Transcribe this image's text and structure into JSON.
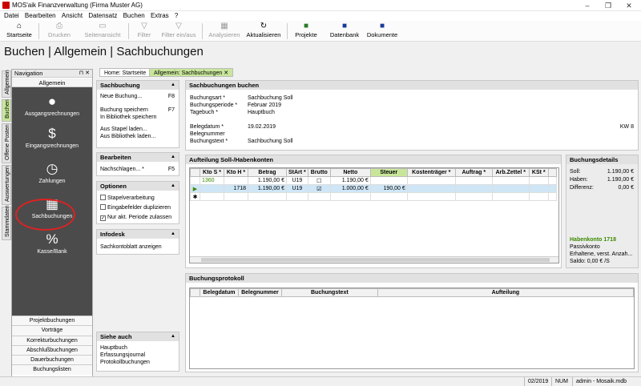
{
  "window": {
    "title": "MOS'aik Finanzverwaltung (Firma Muster AG)",
    "minimize": "–",
    "maximize": "❐",
    "close": "✕"
  },
  "menu": [
    "Datei",
    "Bearbeiten",
    "Ansicht",
    "Datensatz",
    "Buchen",
    "Extras",
    "?"
  ],
  "toolbar": {
    "startseite": "Startseite",
    "drucken": "Drucken",
    "seitenansicht": "Seitenansicht",
    "filter": "Filter",
    "filter_einaus": "Filter ein/aus",
    "analysieren": "Analysieren",
    "aktualisieren": "Aktualisieren",
    "projekte": "Projekte",
    "datenbank": "Datenbank",
    "dokumente": "Dokumente"
  },
  "page_title": "Buchen | Allgemein | Sachbuchungen",
  "navigation": {
    "header": "Navigation",
    "pin": "⊓ ✕",
    "section": "Allgemein",
    "items": [
      "Ausgangsrechnungen",
      "Eingangsrechnungen",
      "Zahlungen",
      "Sachbuchungen",
      "Kasse/Bank"
    ],
    "list": [
      "Projektbuchungen",
      "Vorträge",
      "Korrekturbuchungen",
      "Abschlußbuchungen",
      "Dauerbuchungen",
      "Buchungslisten"
    ]
  },
  "vertical_tabs": [
    "Allgemein",
    "Buchen",
    "Offene Posten",
    "Auswertungen",
    "Stammdaten"
  ],
  "tabs": {
    "home": "Home: Startseite",
    "active": "Allgemein: Sachbuchungen",
    "close": "✕"
  },
  "actions": {
    "sachbuchung": {
      "title": "Sachbuchung",
      "neue": "Neue Buchung...",
      "neue_key": "F8",
      "speichern": "Buchung speichern",
      "speichern_key": "F7",
      "bibliothek_speichern": "In Bibliothek speichern",
      "stapel_laden": "Aus Stapel laden...",
      "bibliothek_laden": "Aus Bibliothek laden..."
    },
    "bearbeiten": {
      "title": "Bearbeiten",
      "nachschlagen": "Nachschlagen...",
      "nachschlagen_star": "*",
      "nachschlagen_key": "F5"
    },
    "optionen": {
      "title": "Optionen",
      "stapel": "Stapelverarbeitung",
      "duplizieren": "Eingabefelder duplizieren",
      "periode": "Nur akt. Periode zulassen",
      "check": "✓"
    },
    "infodesk": {
      "title": "Infodesk",
      "konto": "Sachkontoblatt anzeigen"
    },
    "siehe_auch": {
      "title": "Siehe auch",
      "items": [
        "Hauptbuch",
        "Erfassungsjournal",
        "Protokollbuchungen"
      ]
    }
  },
  "form": {
    "title": "Sachbuchungen buchen",
    "buchungsart_lbl": "Buchungsart *",
    "buchungsart": "Sachbuchung Soll",
    "buchungsperiode_lbl": "Buchungsperiode *",
    "buchungsperiode": "Februar 2019",
    "tagebuch_lbl": "Tagebuch *",
    "tagebuch": "Hauptbuch",
    "belegdatum_lbl": "Belegdatum *",
    "belegdatum": "19.02.2019",
    "kw": "KW 8",
    "belegnummer_lbl": "Belegnummer",
    "buchungstext_lbl": "Buchungstext *",
    "buchungstext": "Sachbuchung Soll"
  },
  "aufteilung": {
    "title": "Aufteilung Soll-/Habenkonten",
    "columns": [
      "Kto S *",
      "Kto H *",
      "Betrag",
      "StArt *",
      "Brutto",
      "Netto",
      "Steuer",
      "Kostenträger *",
      "Auftrag *",
      "Arb.Zettel *",
      "KSt *"
    ],
    "rows": [
      {
        "marker": "",
        "kto_s": "1360",
        "kto_h": "",
        "betrag": "1.190,00 €",
        "start": "U19",
        "brutto": "☐",
        "netto": "1.190,00 €",
        "steuer": ""
      },
      {
        "marker": "▶",
        "kto_s": "",
        "kto_h": "1718",
        "betrag": "1.190,00 €",
        "start": "U19",
        "brutto": "☑",
        "netto": "1.000,00 €",
        "steuer": "190,00 €"
      },
      {
        "marker": "✱",
        "kto_s": "",
        "kto_h": "",
        "betrag": "",
        "start": "",
        "brutto": "",
        "netto": "",
        "steuer": ""
      }
    ]
  },
  "details": {
    "title": "Buchungsdetails",
    "soll_lbl": "Soll:",
    "soll": "1.190,00 €",
    "haben_lbl": "Haben:",
    "haben": "1.190,00 €",
    "diff_lbl": "Differenz:",
    "diff": "0,00 €",
    "konto_title": "Habenkonto 1718",
    "konto_type": "Passivkonto",
    "konto_desc": "Erhaltene, verst. Anzah...",
    "saldo": "Saldo: 0,00 € /S"
  },
  "protokoll": {
    "title": "Buchungsprotokoll",
    "columns": [
      "Belegdatum",
      "Belegnummer",
      "Buchungstext",
      "Aufteilung"
    ]
  },
  "status": {
    "period": "02/2019",
    "num": "NUM",
    "user": "admin - Mosaik.mdb"
  },
  "colors": {
    "accent": "#c8e69a",
    "nav_dark": "#4b4b4b",
    "ellipse": "#dd2222"
  }
}
